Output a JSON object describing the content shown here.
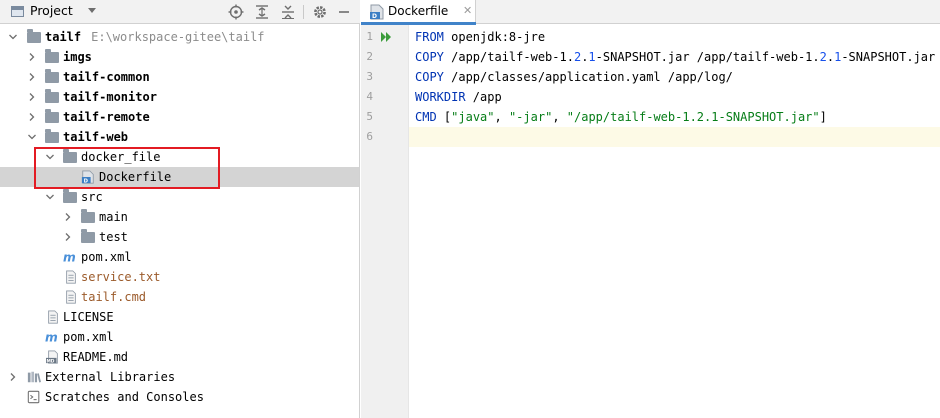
{
  "project_panel": {
    "title": "Project",
    "tree": [
      {
        "id": "root",
        "label": "tailf",
        "path": "E:\\workspace-gitee\\tailf"
      },
      {
        "id": "imgs",
        "label": "imgs"
      },
      {
        "id": "tailf-common",
        "label": "tailf-common"
      },
      {
        "id": "tailf-monitor",
        "label": "tailf-monitor"
      },
      {
        "id": "tailf-remote",
        "label": "tailf-remote"
      },
      {
        "id": "tailf-web",
        "label": "tailf-web"
      },
      {
        "id": "docker_file",
        "label": "docker_file"
      },
      {
        "id": "dockerfile",
        "label": "Dockerfile"
      },
      {
        "id": "src",
        "label": "src"
      },
      {
        "id": "main",
        "label": "main"
      },
      {
        "id": "test",
        "label": "test"
      },
      {
        "id": "pom-web",
        "label": "pom.xml"
      },
      {
        "id": "service-txt",
        "label": "service.txt"
      },
      {
        "id": "tailf-cmd",
        "label": "tailf.cmd"
      },
      {
        "id": "license",
        "label": "LICENSE"
      },
      {
        "id": "pom-root",
        "label": "pom.xml"
      },
      {
        "id": "readme",
        "label": "README.md"
      },
      {
        "id": "external-libs",
        "label": "External Libraries"
      },
      {
        "id": "scratches",
        "label": "Scratches and Consoles"
      }
    ]
  },
  "editor": {
    "tab_label": "Dockerfile",
    "line_numbers": [
      "1",
      "2",
      "3",
      "4",
      "5",
      "6"
    ],
    "code": {
      "l1": {
        "kw": "FROM",
        "rest": " openjdk:8-jre"
      },
      "l2": {
        "kw": "COPY",
        "a": " /app/tailf-web-1.",
        "n1": "2",
        "b": ".",
        "n2": "1",
        "c": "-SNAPSHOT.jar /app/tailf-web-1.",
        "n3": "2",
        "d": ".",
        "n4": "1",
        "e": "-SNAPSHOT.jar"
      },
      "l3": {
        "kw": "COPY",
        "rest": " /app/classes/application.yaml /app/log/"
      },
      "l4": {
        "kw": "WORKDIR",
        "rest": " /app"
      },
      "l5": {
        "kw": "CMD",
        "a": " [",
        "s1": "\"java\"",
        "b": ", ",
        "s2": "\"-jar\"",
        "c": ", ",
        "s3": "\"/app/tailf-web-1.2.1-SNAPSHOT.jar\"",
        "d": "]"
      }
    }
  },
  "colors": {
    "keyword": "#0033b3",
    "number": "#1750eb",
    "string": "#067d17",
    "highlight_box": "#e31b23",
    "tab_underline": "#4083c9"
  },
  "icons": [
    "project-icon",
    "dropdown-icon",
    "locate-icon",
    "expand-all-icon",
    "collapse-all-icon",
    "settings-icon",
    "minimize-icon",
    "folder-icon",
    "dockerfile-icon",
    "maven-icon",
    "text-file-icon",
    "markdown-icon",
    "library-icon",
    "scratches-icon",
    "run-icon",
    "close-icon"
  ]
}
